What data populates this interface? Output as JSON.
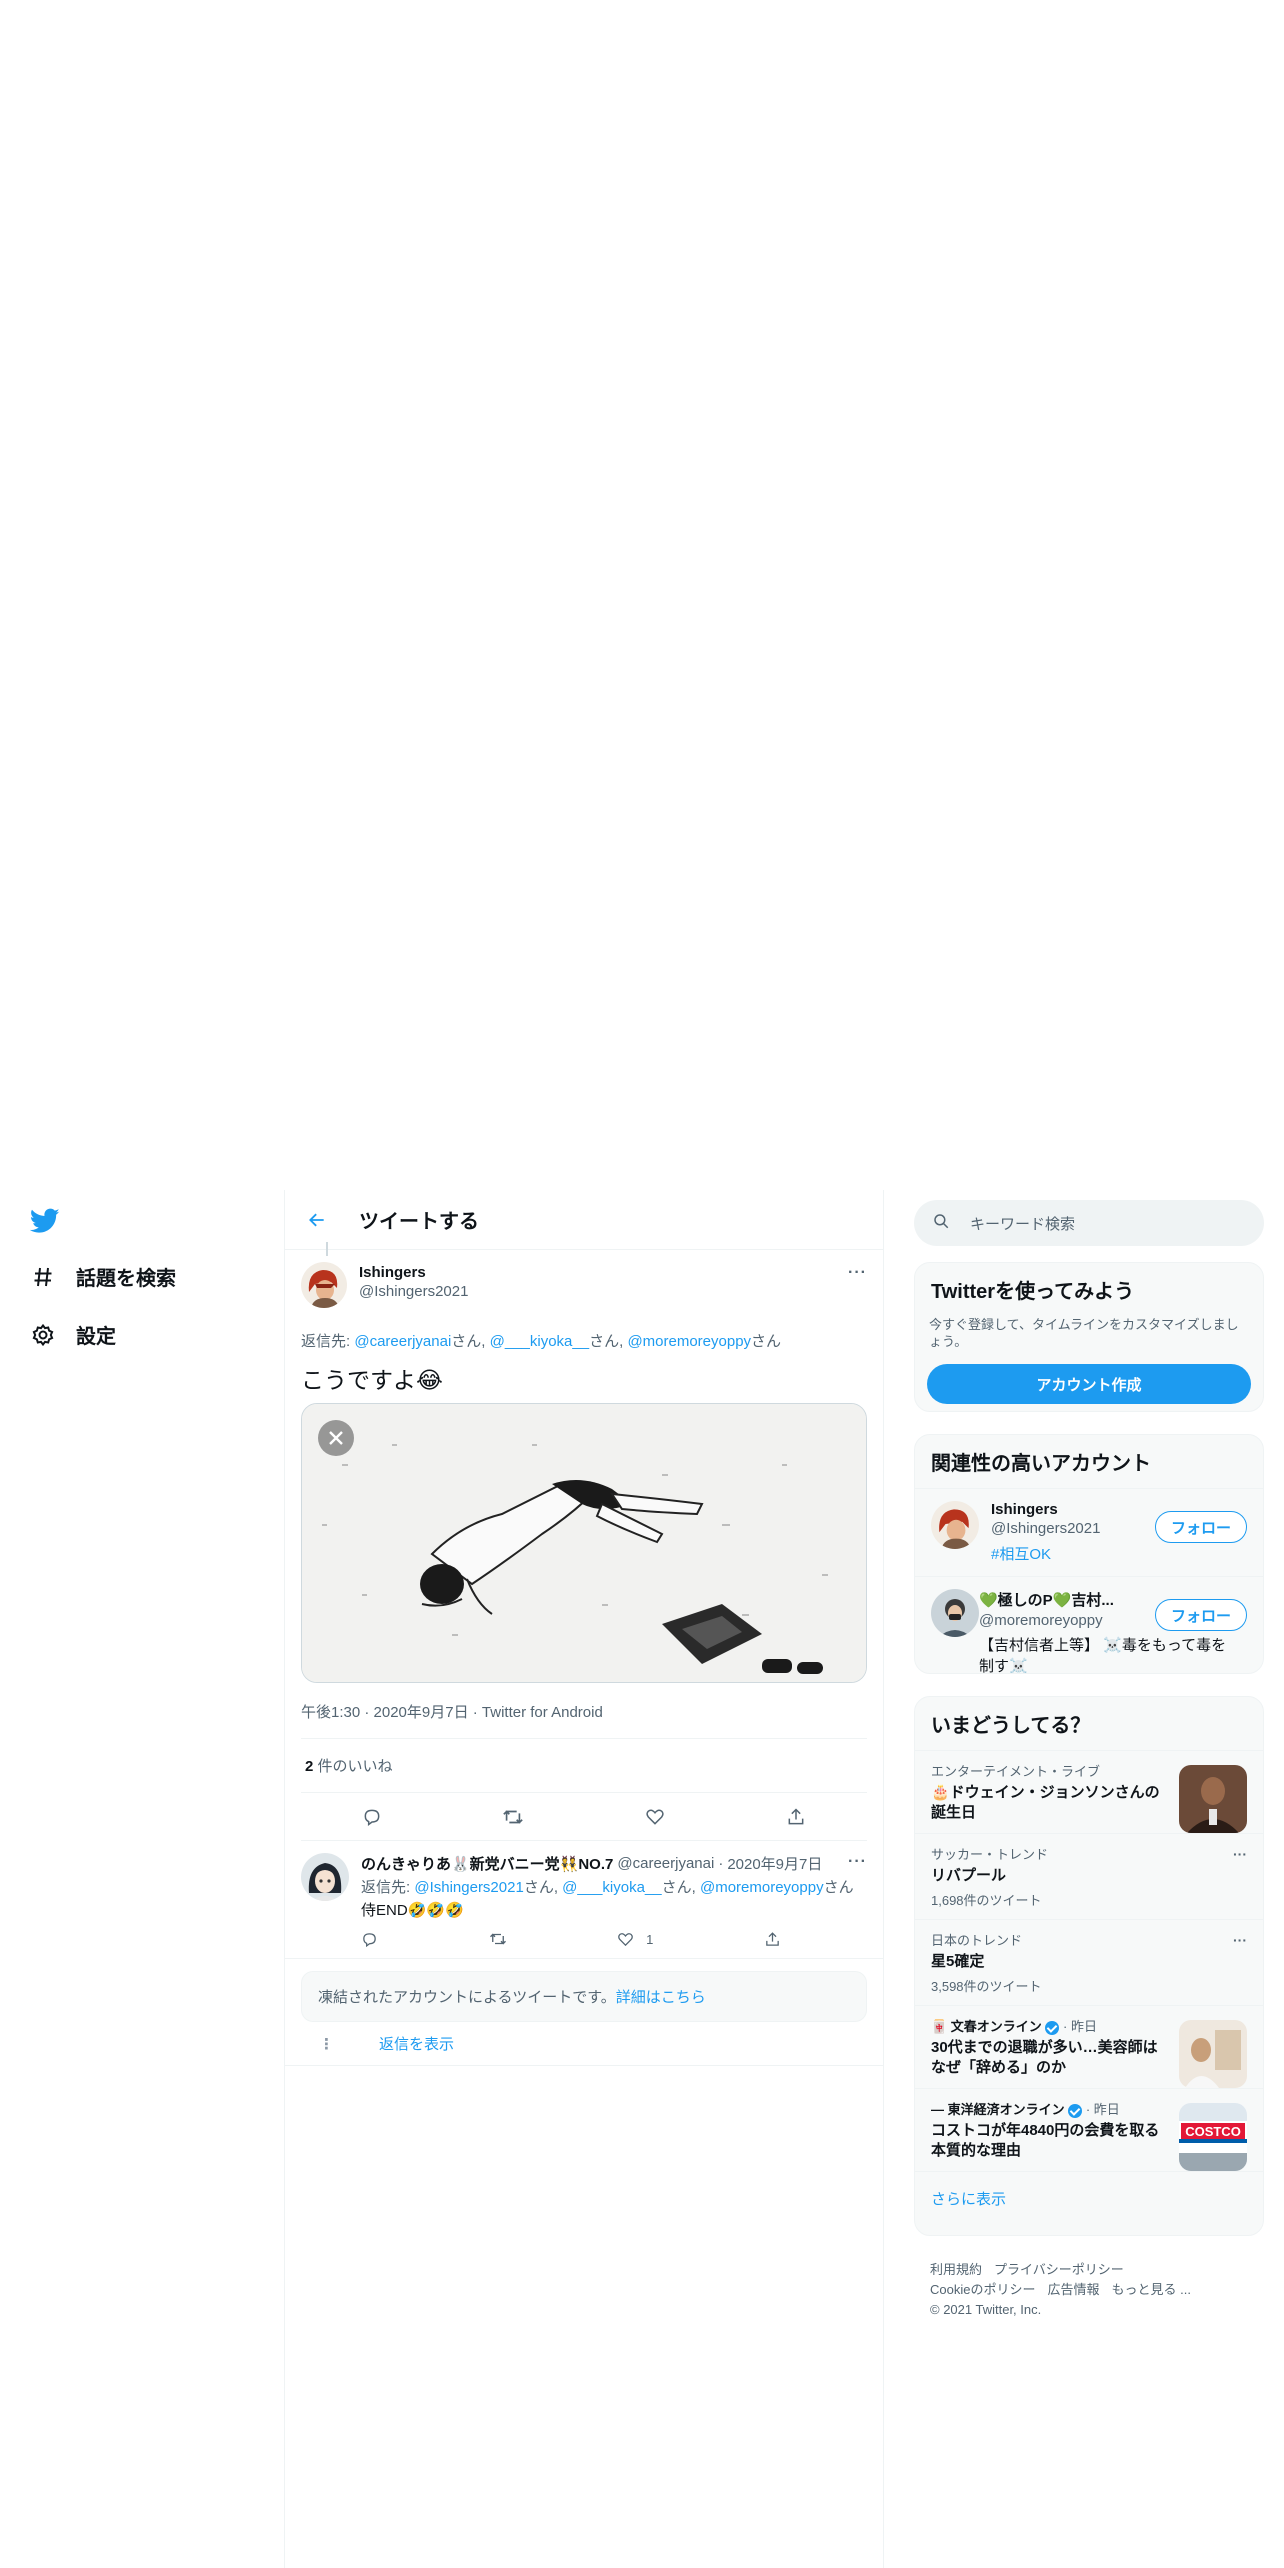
{
  "nav": {
    "explore_label": "話題を検索",
    "settings_label": "設定"
  },
  "header": {
    "title": "ツイートする"
  },
  "main_tweet": {
    "author_name": "Ishingers",
    "author_handle": "@Ishingers2021",
    "reply_prefix": "返信先: ",
    "reply_to": [
      {
        "handle": "@careerjyanai",
        "suffix": "さん, "
      },
      {
        "handle": "@___kiyoka__",
        "suffix": "さん, "
      },
      {
        "handle": "@moremoreyoppy",
        "suffix": "さん"
      }
    ],
    "text": "こうですよ😂",
    "meta": "午後1:30 · 2020年9月7日 · Twitter for Android",
    "likes_count": "2",
    "likes_label": " 件のいいね"
  },
  "reply_tweet": {
    "author_name": "のんきゃりあ🐰新党バニー党👯NO.7",
    "author_handle": "@careerjyanai",
    "date": "2020年9月7日",
    "reply_prefix": "返信先: ",
    "reply_to": [
      {
        "handle": "@Ishingers2021",
        "suffix": "さん, "
      },
      {
        "handle": "@___kiyoka__",
        "suffix": "さん, "
      },
      {
        "handle": "@moremoreyoppy",
        "suffix": "さん"
      }
    ],
    "text": "侍END🤣🤣🤣",
    "like_count": "1"
  },
  "suspended_notice": {
    "text": "凍結されたアカウントによるツイートです。",
    "link": "詳細はこちら"
  },
  "show_replies_label": "返信を表示",
  "search": {
    "placeholder": "キーワード検索"
  },
  "signup_card": {
    "title": "Twitterを使ってみよう",
    "description": "今すぐ登録して、タイムラインをカスタマイズしましょう。",
    "button": "アカウント作成"
  },
  "related_accounts": {
    "title": "関連性の高いアカウント",
    "items": [
      {
        "name": "Ishingers",
        "handle": "@Ishingers2021",
        "bio": "#相互OK",
        "follow": "フォロー"
      },
      {
        "name": "💚極しのP💚吉村...",
        "handle": "@moremoreyoppy",
        "bio": "【吉村信者上等】 ☠️毒をもって毒を制す☠️",
        "follow": "フォロー"
      }
    ]
  },
  "trends": {
    "title": "いまどうしてる？",
    "items": [
      {
        "category": "エンターテイメント・ライブ",
        "title": "🎂ドウェイン・ジョンソンさんの誕生日"
      },
      {
        "category": "サッカー・トレンド",
        "title": "リバプール",
        "count": "1,698件のツイート"
      },
      {
        "category": "日本のトレンド",
        "title": "星5確定",
        "count": "3,598件のツイート"
      },
      {
        "source": "🀄 文春オンライン",
        "time": " · 昨日",
        "title": "30代までの退職が多い…美容師はなぜ「辞める」のか"
      },
      {
        "source": "— 東洋経済オンライン",
        "time": " · 昨日",
        "title": "コストコが年4840円の会費を取る本質的な理由",
        "thumb_text": "COSTCO"
      }
    ],
    "show_more": "さらに表示"
  },
  "footer": {
    "terms": "利用規約",
    "privacy": "プライバシーポリシー",
    "cookie": "Cookieのポリシー",
    "ads": "広告情報",
    "more": "もっと見る ...",
    "copyright": "© 2021 Twitter, Inc."
  },
  "colors": {
    "accent": "#1d9bf0",
    "text": "#0f1419",
    "muted": "#536471",
    "border": "#eff3f4"
  }
}
